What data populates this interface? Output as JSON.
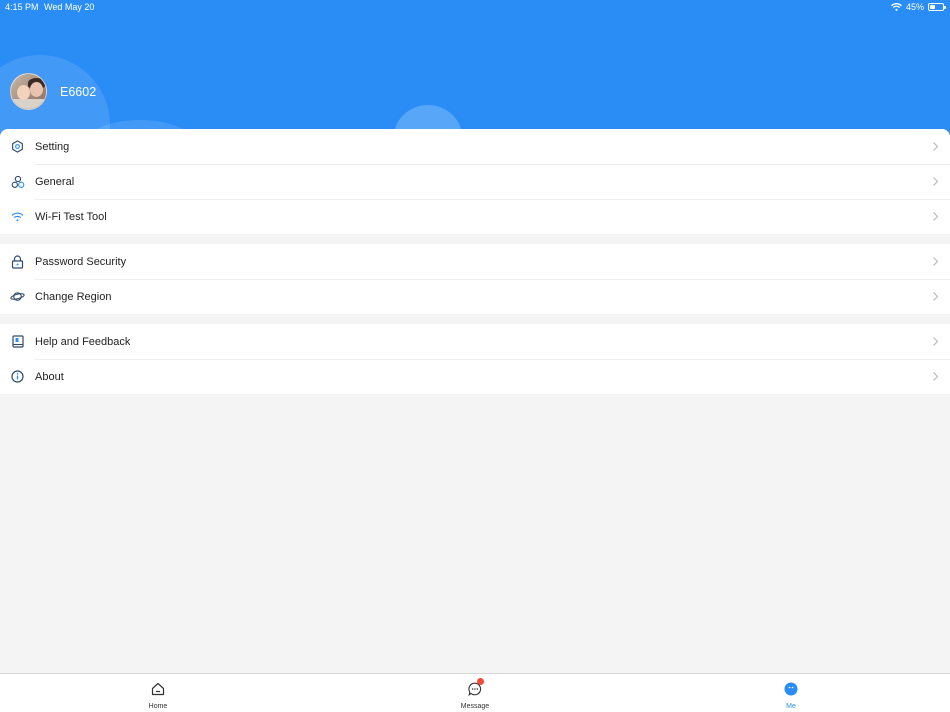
{
  "status_bar": {
    "time": "4:15 PM",
    "date": "Wed May 20",
    "battery": "45%",
    "wifi_icon": "wifi-icon",
    "battery_icon": "battery-icon"
  },
  "profile": {
    "username": "E6602",
    "avatar_icon": "avatar-photo"
  },
  "menu": {
    "groups": [
      {
        "items": [
          {
            "label": "Setting",
            "icon": "setting-hexagon-icon"
          },
          {
            "label": "General",
            "icon": "general-circles-icon"
          },
          {
            "label": "Wi-Fi Test Tool",
            "icon": "wifi-icon"
          }
        ]
      },
      {
        "items": [
          {
            "label": "Password Security",
            "icon": "lock-icon"
          },
          {
            "label": "Change Region",
            "icon": "planet-icon"
          }
        ]
      },
      {
        "items": [
          {
            "label": "Help and Feedback",
            "icon": "book-icon"
          },
          {
            "label": "About",
            "icon": "info-icon"
          }
        ]
      }
    ]
  },
  "tabbar": {
    "tabs": [
      {
        "label": "Home",
        "icon": "home-icon",
        "active": false
      },
      {
        "label": "Message",
        "icon": "message-icon",
        "active": false,
        "has_badge": true
      },
      {
        "label": "Me",
        "icon": "me-icon",
        "active": true
      }
    ]
  },
  "colors": {
    "accent": "#2a8df5",
    "badge": "#f04a3c",
    "background": "#f4f4f4",
    "icon": "#2d4a6b"
  }
}
